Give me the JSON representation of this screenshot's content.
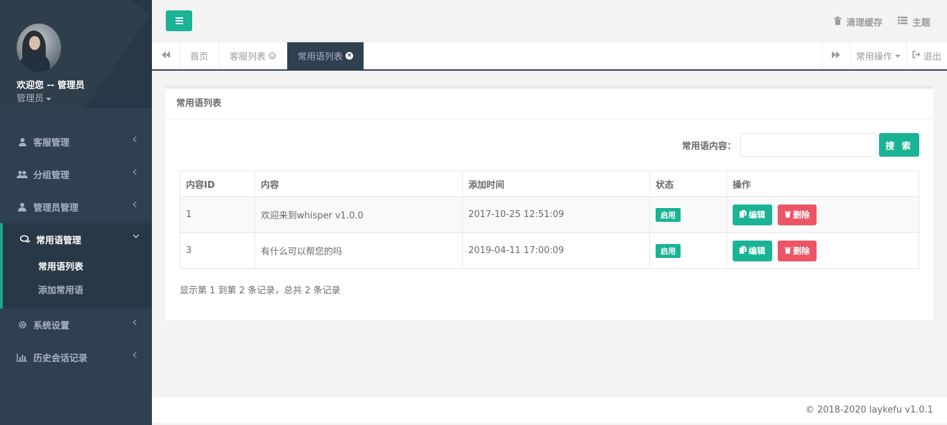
{
  "profile": {
    "welcome": "欢迎您 -- 管理员",
    "role": "管理员"
  },
  "sidebar": {
    "items": [
      {
        "label": "客服管理",
        "icon": "user-icon"
      },
      {
        "label": "分组管理",
        "icon": "users-icon"
      },
      {
        "label": "管理员管理",
        "icon": "user-icon"
      },
      {
        "label": "常用语管理",
        "icon": "chat-icon",
        "active": true,
        "children": [
          {
            "label": "常用语列表",
            "current": true
          },
          {
            "label": "添加常用语"
          }
        ]
      },
      {
        "label": "系统设置",
        "icon": "gear-icon"
      },
      {
        "label": "历史会话记录",
        "icon": "bar-chart-icon"
      }
    ]
  },
  "header": {
    "clear_cache": "清理缓存",
    "theme": "主题"
  },
  "tabs": [
    {
      "label": "首页",
      "closable": false
    },
    {
      "label": "客服列表",
      "closable": true
    },
    {
      "label": "常用语列表",
      "closable": true,
      "active": true
    }
  ],
  "tabs_right": {
    "operations": "常用操作",
    "logout": "退出"
  },
  "panel": {
    "title": "常用语列表",
    "search_label": "常用语内容：",
    "search_value": "",
    "search_button": "搜 索"
  },
  "table": {
    "columns": [
      "内容ID",
      "内容",
      "添加时间",
      "状态",
      "操作"
    ],
    "rows": [
      {
        "id": "1",
        "content": "欢迎来到whisper v1.0.0",
        "time": "2017-10-25 12:51:09",
        "status": "启用"
      },
      {
        "id": "3",
        "content": "有什么可以帮您的吗",
        "time": "2019-04-11 17:00:09",
        "status": "启用"
      }
    ],
    "edit_label": "编辑",
    "delete_label": "删除"
  },
  "pagination": {
    "info": "显示第 1 到第 2 条记录，总共 2 条记录"
  },
  "footer": {
    "copyright": "© 2018-2020 laykefu v1.0.1"
  },
  "colors": {
    "accent": "#1ab394",
    "danger": "#ed5565",
    "sidebar": "#2f4050"
  }
}
